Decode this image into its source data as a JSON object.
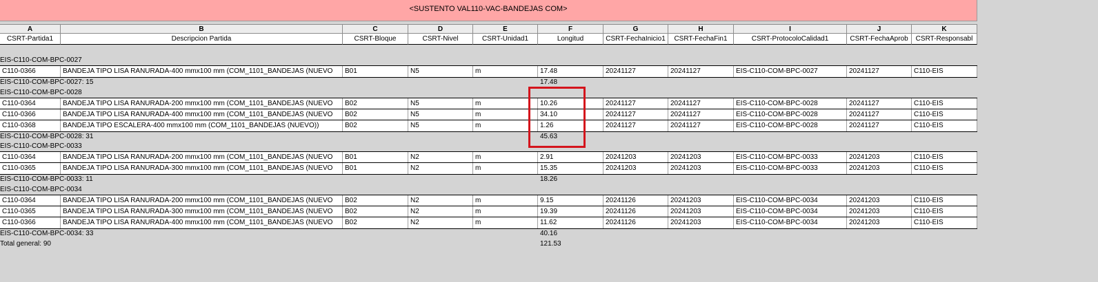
{
  "title": "<SUSTENTO VAL110-VAC-BANDEJAS COM>",
  "columns": [
    "A",
    "B",
    "C",
    "D",
    "E",
    "F",
    "G",
    "H",
    "I",
    "J",
    "K"
  ],
  "headers": [
    "CSRT-Partida1",
    "Descripcion Partida",
    "CSRT-Bloque",
    "CSRT-Nivel",
    "CSRT-Unidad1",
    "Longitud",
    "CSRT-FechaInicio1",
    "CSRT-FechaFin1",
    "CSRT-ProtocoloCalidad1",
    "CSRT-FechaAprob",
    "CSRT-Responsabl"
  ],
  "groups": [
    {
      "name": "EIS-C110-COM-BPC-0027",
      "rows": [
        [
          "C110-0366",
          "BANDEJA TIPO LISA RANURADA-400 mmx100 mm (COM_1101_BANDEJAS (NUEVO",
          "B01",
          "N5",
          "m",
          "17.48",
          "20241127",
          "20241127",
          "EIS-C110-COM-BPC-0027",
          "20241127",
          "C110-EIS"
        ]
      ],
      "subtotal_label": "EIS-C110-COM-BPC-0027: 15",
      "subtotal_value": "17.48"
    },
    {
      "name": "EIS-C110-COM-BPC-0028",
      "rows": [
        [
          "C110-0364",
          "BANDEJA TIPO LISA RANURADA-200 mmx100 mm (COM_1101_BANDEJAS (NUEVO",
          "B02",
          "N5",
          "m",
          "10.26",
          "20241127",
          "20241127",
          "EIS-C110-COM-BPC-0028",
          "20241127",
          "C110-EIS"
        ],
        [
          "C110-0366",
          "BANDEJA TIPO LISA RANURADA-400 mmx100 mm (COM_1101_BANDEJAS (NUEVO",
          "B02",
          "N5",
          "m",
          "34.10",
          "20241127",
          "20241127",
          "EIS-C110-COM-BPC-0028",
          "20241127",
          "C110-EIS"
        ],
        [
          "C110-0368",
          "BANDEJA TIPO ESCALERA-400 mmx100 mm (COM_1101_BANDEJAS (NUEVO))",
          "B02",
          "N5",
          "m",
          "1.26",
          "20241127",
          "20241127",
          "EIS-C110-COM-BPC-0028",
          "20241127",
          "C110-EIS"
        ]
      ],
      "subtotal_label": "EIS-C110-COM-BPC-0028: 31",
      "subtotal_value": "45.63"
    },
    {
      "name": "EIS-C110-COM-BPC-0033",
      "rows": [
        [
          "C110-0364",
          "BANDEJA TIPO LISA RANURADA-200 mmx100 mm (COM_1101_BANDEJAS (NUEVO",
          "B01",
          "N2",
          "m",
          "2.91",
          "20241203",
          "20241203",
          "EIS-C110-COM-BPC-0033",
          "20241203",
          "C110-EIS"
        ],
        [
          "C110-0365",
          "BANDEJA TIPO LISA RANURADA-300 mmx100 mm (COM_1101_BANDEJAS (NUEVO",
          "B01",
          "N2",
          "m",
          "15.35",
          "20241203",
          "20241203",
          "EIS-C110-COM-BPC-0033",
          "20241203",
          "C110-EIS"
        ]
      ],
      "subtotal_label": "EIS-C110-COM-BPC-0033: 11",
      "subtotal_value": "18.26"
    },
    {
      "name": "EIS-C110-COM-BPC-0034",
      "rows": [
        [
          "C110-0364",
          "BANDEJA TIPO LISA RANURADA-200 mmx100 mm (COM_1101_BANDEJAS (NUEVO",
          "B02",
          "N2",
          "m",
          "9.15",
          "20241126",
          "20241203",
          "EIS-C110-COM-BPC-0034",
          "20241203",
          "C110-EIS"
        ],
        [
          "C110-0365",
          "BANDEJA TIPO LISA RANURADA-300 mmx100 mm (COM_1101_BANDEJAS (NUEVO",
          "B02",
          "N2",
          "m",
          "19.39",
          "20241126",
          "20241203",
          "EIS-C110-COM-BPC-0034",
          "20241203",
          "C110-EIS"
        ],
        [
          "C110-0366",
          "BANDEJA TIPO LISA RANURADA-400 mmx100 mm (COM_1101_BANDEJAS (NUEVO",
          "B02",
          "N2",
          "m",
          "11.62",
          "20241126",
          "20241203",
          "EIS-C110-COM-BPC-0034",
          "20241203",
          "C110-EIS"
        ]
      ],
      "subtotal_label": "EIS-C110-COM-BPC-0034: 33",
      "subtotal_value": "40.16"
    }
  ],
  "grand_total_label": "Total general: 90",
  "grand_total_value": "121.53",
  "highlight_color": "#d4141c"
}
